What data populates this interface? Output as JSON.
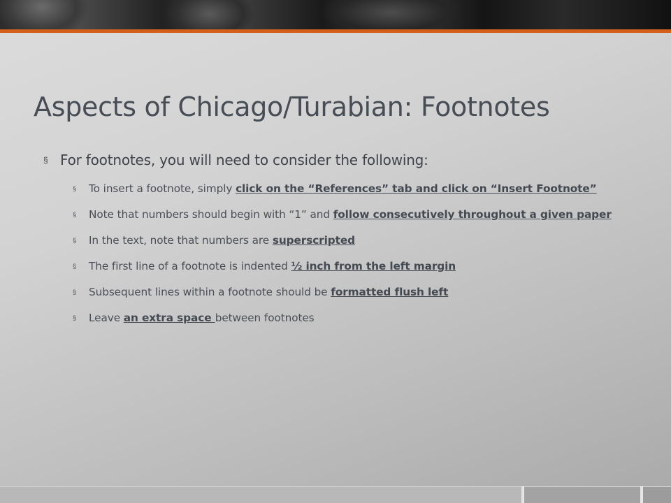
{
  "slide": {
    "title": "Aspects of Chicago/Turabian: Footnotes",
    "bullet_glyph": "§",
    "main_point": "For footnotes, you will need to consider the following:",
    "sub_points": [
      {
        "text_before": "To insert a footnote, simply ",
        "emphasis": "click on the “References” tab and click on “Insert Footnote”",
        "text_after": ""
      },
      {
        "text_before": "Note that numbers should begin with “1” and ",
        "emphasis": "follow consecutively throughout a given paper",
        "text_after": ""
      },
      {
        "text_before": "In the text, note that numbers are ",
        "emphasis": "superscripted",
        "text_after": ""
      },
      {
        "text_before": "The first line of a footnote is indented ",
        "emphasis": "½ inch from the left margin",
        "text_after": ""
      },
      {
        "text_before": "Subsequent lines within a footnote should be ",
        "emphasis": "formatted flush left",
        "text_after": ""
      },
      {
        "text_before": "Leave ",
        "emphasis": "an extra space ",
        "text_after": "between footnotes"
      }
    ]
  },
  "theme": {
    "accent_color": "#d35f1c",
    "title_color": "#474d55",
    "body_text_color": "#4a4f55",
    "background_color": "#d2d2d2"
  }
}
